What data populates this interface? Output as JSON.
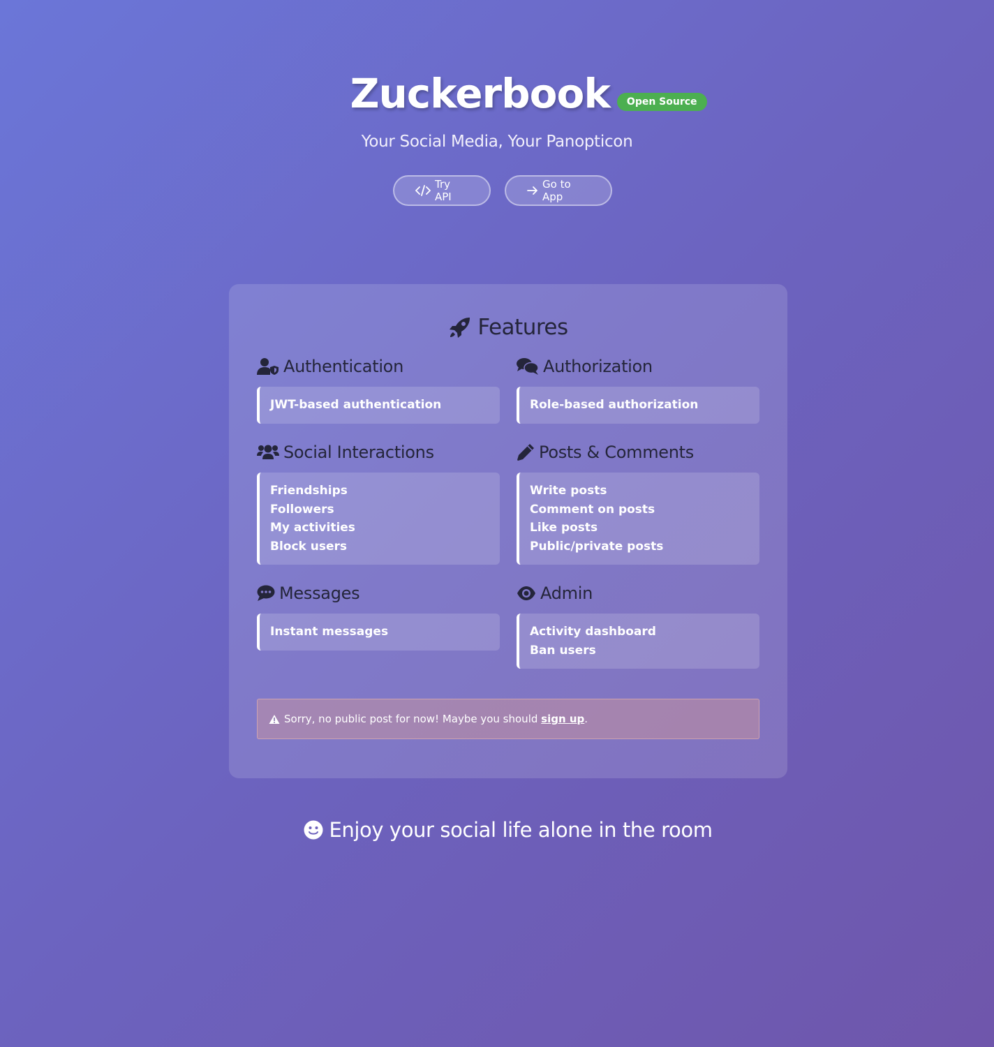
{
  "hero": {
    "title": "Zuckerbook",
    "badge": "Open Source",
    "subtitle": "Your Social Media, Your Panopticon",
    "buttons": [
      {
        "label": "Try API",
        "icon": "code-icon"
      },
      {
        "label": "Go to App",
        "icon": "arrow-right-icon"
      }
    ]
  },
  "features": {
    "title": "Features",
    "title_icon": "rocket-icon",
    "sections": [
      {
        "title": "Authentication",
        "icon": "user-shield-icon",
        "items": [
          "JWT-based authentication"
        ]
      },
      {
        "title": "Authorization",
        "icon": "comments-icon",
        "items": [
          "Role-based authorization"
        ]
      },
      {
        "title": "Social Interactions",
        "icon": "users-icon",
        "items": [
          "Friendships",
          "Followers",
          "My activities",
          "Block users"
        ]
      },
      {
        "title": "Posts & Comments",
        "icon": "pencil-icon",
        "items": [
          "Write posts",
          "Comment on posts",
          "Like posts",
          "Public/private posts"
        ]
      },
      {
        "title": "Messages",
        "icon": "comment-dots-icon",
        "items": [
          "Instant messages"
        ]
      },
      {
        "title": "Admin",
        "icon": "eye-icon",
        "items": [
          "Activity dashboard",
          "Ban users"
        ]
      }
    ]
  },
  "alert": {
    "icon": "warning-icon",
    "text": "Sorry, no public post for now! Maybe you should",
    "link": "sign up",
    "suffix": "."
  },
  "footer": {
    "icon": "smile-icon",
    "text": "Enjoy your social life alone in the room"
  },
  "colors": {
    "badge": "#4caf50",
    "heading_dark": "#24253a",
    "background_start": "#6b76d8",
    "background_end": "#6f56ab"
  }
}
